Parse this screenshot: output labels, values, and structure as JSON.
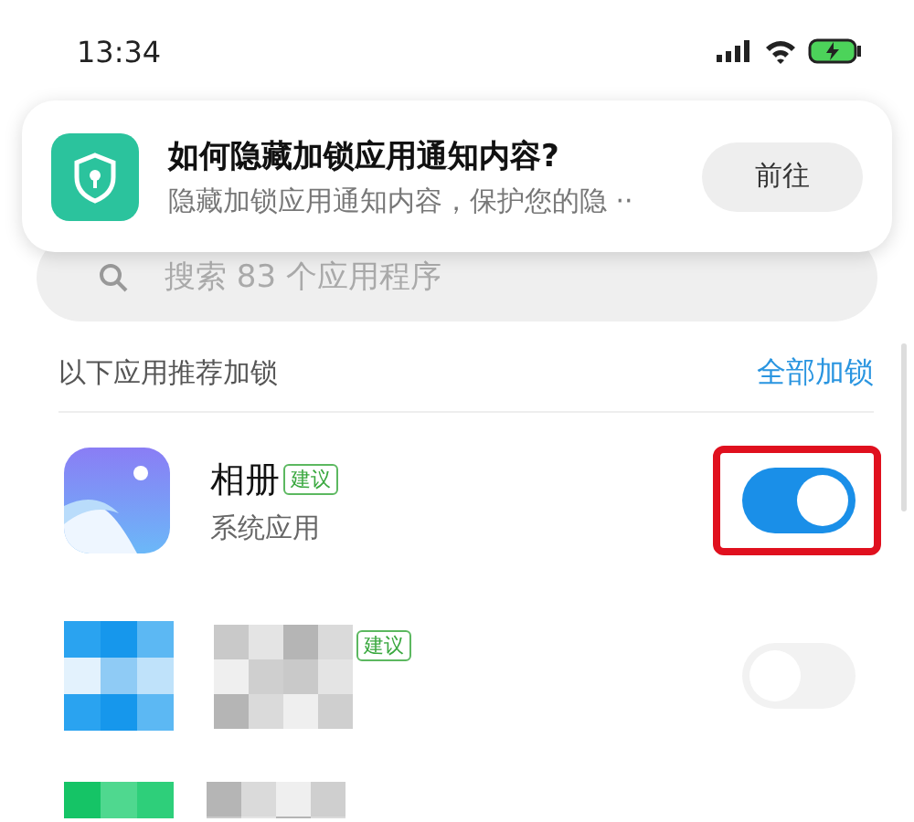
{
  "status_bar": {
    "time": "13:34"
  },
  "notification": {
    "title": "如何隐藏加锁应用通知内容?",
    "text": "隐藏加锁应用通知内容，保护您的隐 ··",
    "button": "前往"
  },
  "search": {
    "placeholder": "搜索 83 个应用程序"
  },
  "section": {
    "title": "以下应用推荐加锁",
    "action": "全部加锁"
  },
  "apps": [
    {
      "kind": "app",
      "name": "相册",
      "badge": "建议",
      "subtitle": "系统应用",
      "on": true,
      "highlighted": true
    },
    {
      "kind": "pixelated",
      "badge": "建议",
      "on": false
    },
    {
      "kind": "pixelated-partial"
    }
  ]
}
